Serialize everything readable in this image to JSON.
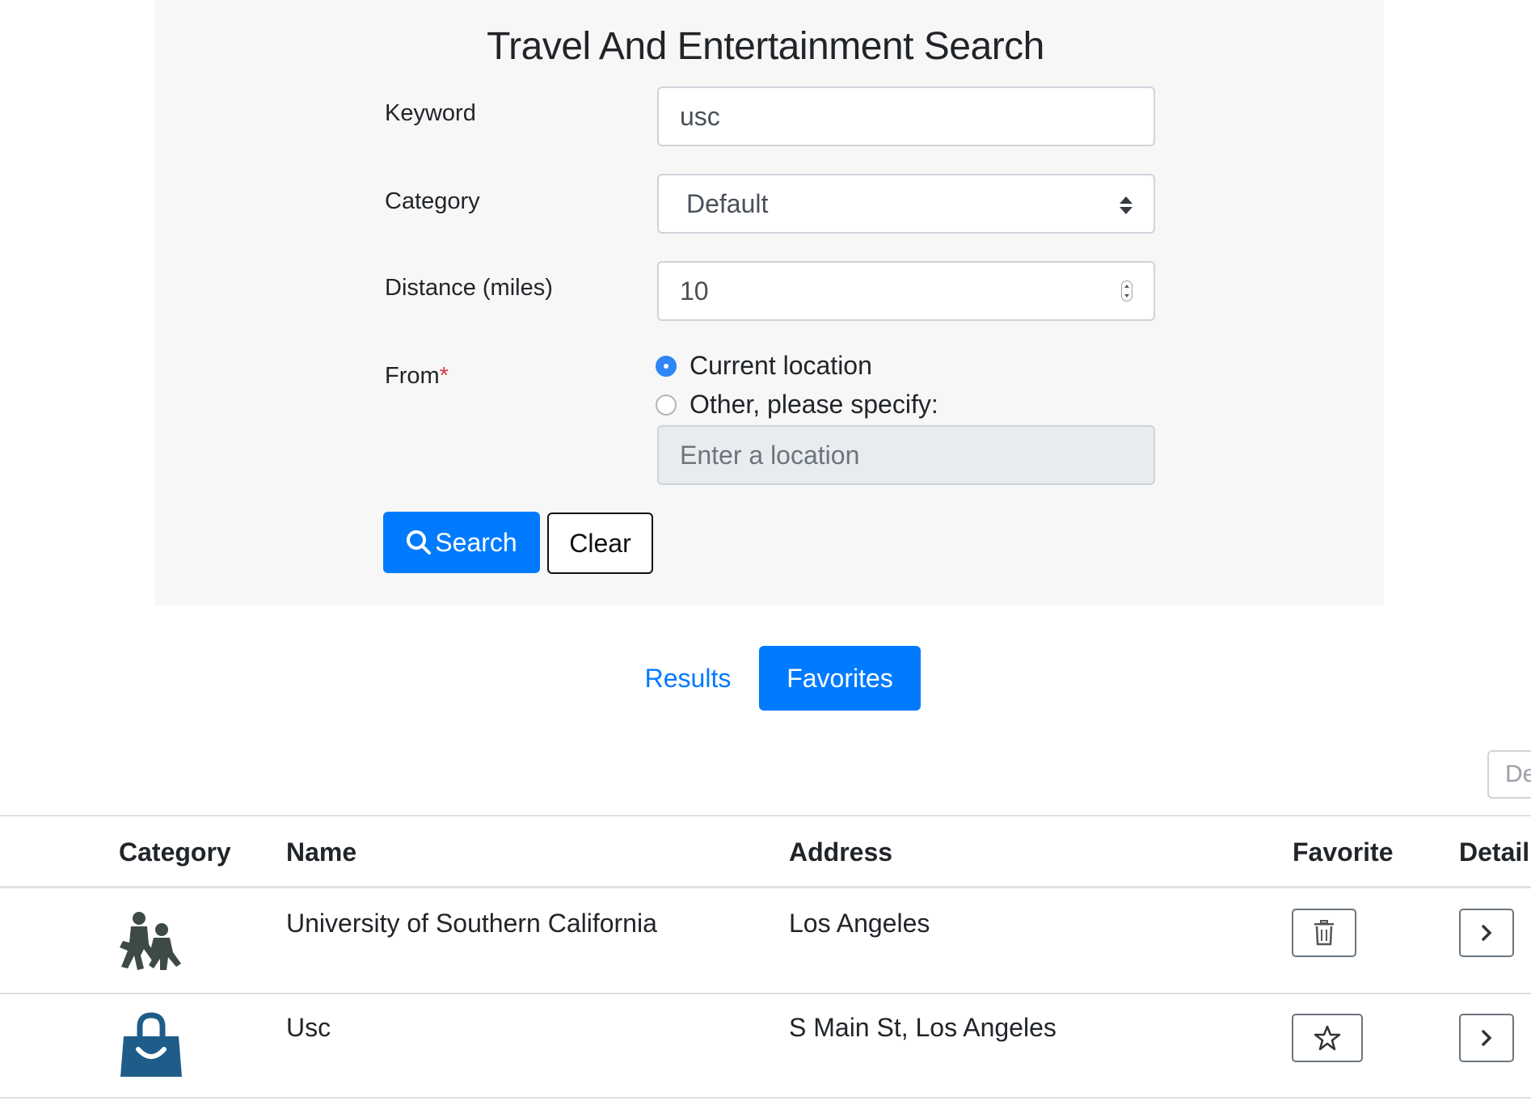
{
  "header": {
    "title": "Travel And Entertainment Search"
  },
  "form": {
    "keyword": {
      "label": "Keyword",
      "value": "usc"
    },
    "category": {
      "label": "Category",
      "value": "Default"
    },
    "distance": {
      "label": "Distance (miles)",
      "value": "10"
    },
    "from": {
      "label": "From",
      "required_mark": "*",
      "options": [
        {
          "label": "Current location",
          "checked": true
        },
        {
          "label": "Other, please specify:",
          "checked": false
        }
      ],
      "location_placeholder": "Enter a location"
    },
    "search_label": "Search",
    "clear_label": "Clear"
  },
  "tabs": [
    {
      "label": "Results",
      "active": false
    },
    {
      "label": "Favorites",
      "active": true
    }
  ],
  "toolbar": {
    "details_label": "De"
  },
  "table": {
    "headers": [
      "Category",
      "Name",
      "Address",
      "Favorite",
      "Detail"
    ],
    "rows": [
      {
        "category_icon": "school-icon",
        "name": "University of Southern California",
        "address": "Los Angeles",
        "favorite_icon": "trash-icon",
        "detail_icon": "chevron-right-icon"
      },
      {
        "category_icon": "shopping-bag-icon",
        "name": "Usc",
        "address": "S Main St, Los Angeles",
        "favorite_icon": "star-outline-icon",
        "detail_icon": "chevron-right-icon"
      }
    ]
  },
  "colors": {
    "primary": "#007bff",
    "panel_bg": "#f7f7f7",
    "required": "#dc3545",
    "category_icon_dark": "#3d4a45",
    "bag_blue": "#1f5c8a"
  }
}
